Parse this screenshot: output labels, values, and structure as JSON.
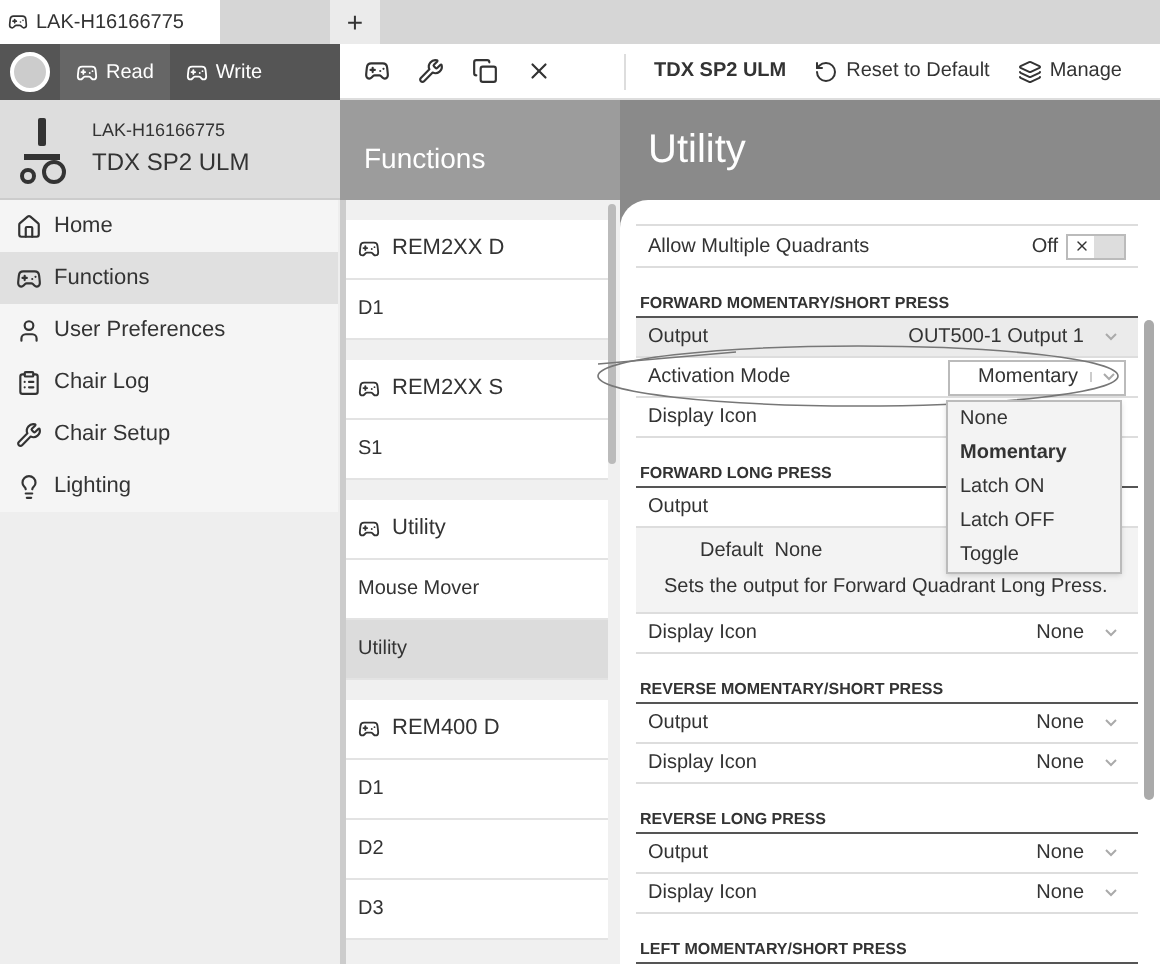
{
  "tabs": [
    {
      "label": "LAK-H16166775",
      "selected": true
    }
  ],
  "new_tab": "+",
  "toolbar": {
    "read": "Read",
    "write": "Write",
    "device": "TDX SP2 ULM",
    "reset": "Reset to Default",
    "manage": "Manage"
  },
  "device": {
    "id": "LAK-H16166775",
    "model": "TDX SP2 ULM"
  },
  "nav": [
    {
      "label": "Home",
      "selected": false
    },
    {
      "label": "Functions",
      "selected": true
    },
    {
      "label": "User Preferences",
      "selected": false
    },
    {
      "label": "Chair Log",
      "selected": false
    },
    {
      "label": "Chair Setup",
      "selected": false
    },
    {
      "label": "Lighting",
      "selected": false
    }
  ],
  "functions": {
    "title": "Functions",
    "groups": [
      {
        "name": "REM2XX D",
        "items": [
          {
            "label": "D1",
            "selected": false
          }
        ]
      },
      {
        "name": "REM2XX S",
        "items": [
          {
            "label": "S1",
            "selected": false
          }
        ]
      },
      {
        "name": "Utility",
        "items": [
          {
            "label": "Mouse Mover",
            "selected": false
          },
          {
            "label": "Utility",
            "selected": true
          }
        ]
      },
      {
        "name": "REM400 D",
        "items": [
          {
            "label": "D1",
            "selected": false
          },
          {
            "label": "D2",
            "selected": false
          },
          {
            "label": "D3",
            "selected": false
          }
        ]
      }
    ]
  },
  "utility": {
    "title": "Utility",
    "rows": [
      {
        "kind": "toggle",
        "label": "Allow Multiple Quadrants",
        "value": "Off",
        "on": false
      },
      {
        "kind": "section",
        "label": "FORWARD MOMENTARY/SHORT PRESS"
      },
      {
        "kind": "select",
        "label": "Output",
        "value": "OUT500-1 Output 1",
        "highlighted": true,
        "open": false
      },
      {
        "kind": "select",
        "label": "Activation Mode",
        "value": "Momentary",
        "highlighted": false,
        "open": true
      },
      {
        "kind": "select",
        "label": "Display Icon",
        "value": "",
        "highlighted": false,
        "open": false
      },
      {
        "kind": "section",
        "label": "FORWARD LONG PRESS"
      },
      {
        "kind": "select",
        "label": "Output",
        "value": "",
        "highlighted": false,
        "open": false
      },
      {
        "kind": "help",
        "default_label": "Default",
        "default_value": "None",
        "text": "Sets the output for Forward Quadrant Long Press."
      },
      {
        "kind": "select",
        "label": "Display Icon",
        "value": "None",
        "highlighted": false,
        "open": false
      },
      {
        "kind": "section",
        "label": "REVERSE MOMENTARY/SHORT PRESS"
      },
      {
        "kind": "select",
        "label": "Output",
        "value": "None",
        "highlighted": false,
        "open": false
      },
      {
        "kind": "select",
        "label": "Display Icon",
        "value": "None",
        "highlighted": false,
        "open": false
      },
      {
        "kind": "section",
        "label": "REVERSE LONG PRESS"
      },
      {
        "kind": "select",
        "label": "Output",
        "value": "None",
        "highlighted": false,
        "open": false
      },
      {
        "kind": "select",
        "label": "Display Icon",
        "value": "None",
        "highlighted": false,
        "open": false
      },
      {
        "kind": "section",
        "label": "LEFT MOMENTARY/SHORT PRESS"
      }
    ]
  },
  "dropdown": [
    {
      "label": "None",
      "selected": false
    },
    {
      "label": "Momentary",
      "selected": true
    },
    {
      "label": "Latch ON",
      "selected": false
    },
    {
      "label": "Latch OFF",
      "selected": false
    },
    {
      "label": "Toggle",
      "selected": false
    }
  ]
}
